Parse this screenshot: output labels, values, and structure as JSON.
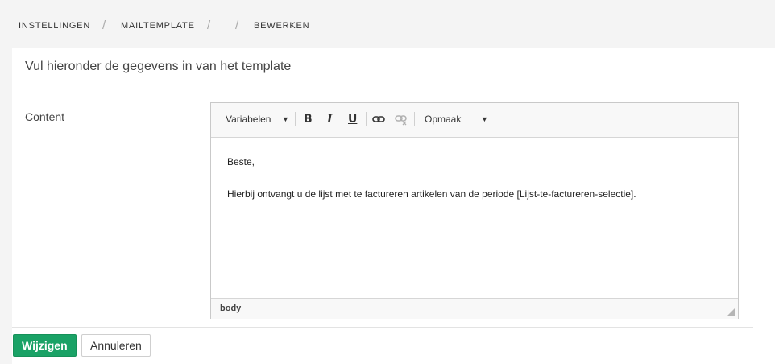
{
  "breadcrumb": {
    "items": [
      "INSTELLINGEN",
      "MAILTEMPLATE",
      "",
      "BEWERKEN"
    ],
    "separator": "/"
  },
  "form": {
    "heading": "Vul hieronder de gegevens in van het template",
    "content_label": "Content"
  },
  "editor": {
    "toolbar": {
      "variables_label": "Variabelen",
      "bold": "B",
      "italic": "I",
      "underline": "U",
      "format_label": "Opmaak"
    },
    "content": {
      "line1": "Beste,",
      "line2": "Hierbij ontvangt u de lijst met te factureren artikelen van de periode [Lijst-te-factureren-selectie]."
    },
    "status_path": "body"
  },
  "actions": {
    "save_label": "Wijzigen",
    "cancel_label": "Annuleren"
  },
  "colors": {
    "primary": "#1aa266",
    "background": "#f4f4f4"
  }
}
